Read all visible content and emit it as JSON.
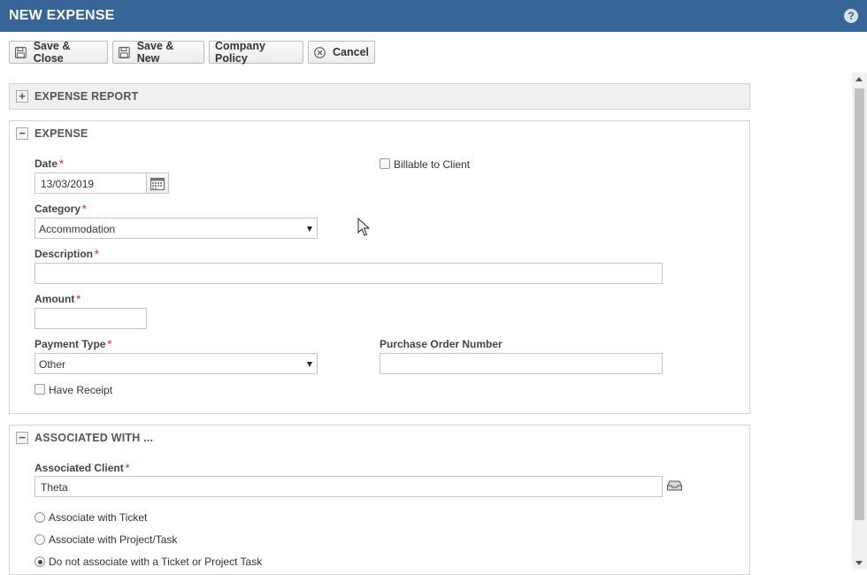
{
  "header": {
    "title": "NEW EXPENSE",
    "help_icon": "?"
  },
  "toolbar": {
    "save_close": "Save & Close",
    "save_new": "Save & New",
    "company_policy": "Company Policy",
    "cancel": "Cancel"
  },
  "sections": {
    "expense_report": {
      "title": "EXPENSE REPORT",
      "toggle": "+"
    },
    "expense": {
      "title": "EXPENSE",
      "toggle": "−"
    },
    "associated": {
      "title": "ASSOCIATED WITH ...",
      "toggle": "−"
    }
  },
  "expense": {
    "date_label": "Date",
    "date_value": "13/03/2019",
    "billable_label": "Billable to Client",
    "billable_checked": false,
    "category_label": "Category",
    "category_value": "Accommodation",
    "description_label": "Description",
    "description_value": "",
    "amount_label": "Amount",
    "amount_value": "",
    "payment_type_label": "Payment Type",
    "payment_type_value": "Other",
    "po_number_label": "Purchase Order Number",
    "po_number_value": "",
    "have_receipt_label": "Have Receipt",
    "have_receipt_checked": false,
    "required_marker": "*"
  },
  "associated": {
    "client_label": "Associated Client",
    "client_value": "Theta",
    "options": [
      {
        "label": "Associate with Ticket",
        "selected": false
      },
      {
        "label": "Associate with Project/Task",
        "selected": false
      },
      {
        "label": "Do not associate with a Ticket or Project Task",
        "selected": true
      }
    ]
  },
  "colors": {
    "header_bg": "#376597",
    "required": "#d9534f"
  }
}
